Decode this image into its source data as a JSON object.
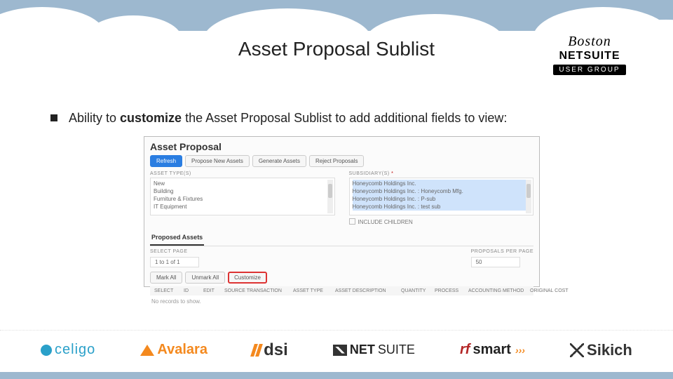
{
  "header": {
    "title": "Asset Proposal Sublist",
    "badge_boston": "Boston",
    "badge_netsuite": "NETSUITE",
    "badge_usergroup": "USER GROUP"
  },
  "bullet": {
    "pre": "Ability to ",
    "bold": "customize",
    "post": " the Asset Proposal Sublist to add additional fields to view:"
  },
  "panel": {
    "title": "Asset Proposal",
    "buttons": {
      "refresh": "Refresh",
      "propose": "Propose New Assets",
      "generate": "Generate Assets",
      "reject": "Reject Proposals"
    },
    "left_label": "ASSET TYPE(S)",
    "right_label": "SUBSIDIARY(S)",
    "asset_types": [
      "New",
      "Building",
      "Furniture & Fixtures",
      "IT Equipment"
    ],
    "subsidiaries": [
      "Honeycomb Holdings Inc.",
      "Honeycomb Holdings Inc. : Honeycomb Mfg.",
      "Honeycomb Holdings Inc. : P-sub",
      "Honeycomb Holdings Inc. : test sub"
    ],
    "include_children": "INCLUDE CHILDREN",
    "tab": "Proposed Assets",
    "pager_left_label": "SELECT PAGE",
    "pager_left_value": "1 to 1 of 1",
    "pager_right_label": "PROPOSALS PER PAGE",
    "pager_right_value": "50",
    "actions": {
      "mark": "Mark All",
      "unmark": "Unmark All",
      "customize": "Customize"
    },
    "grid_headers": [
      "SELECT",
      "ID",
      "EDIT",
      "SOURCE TRANSACTION",
      "ASSET TYPE",
      "ASSET DESCRIPTION",
      "QUANTITY",
      "PROCESS",
      "ACCOUNTING METHOD",
      "ORIGINAL COST"
    ],
    "no_results": "No records to show."
  },
  "footer_logos": {
    "celigo": "celigo",
    "avalara": "Avalara",
    "dsi": "dsi",
    "netsuite_a": "NET",
    "netsuite_b": "SUITE",
    "rfsmart_a": "rf",
    "rfsmart_b": "smart",
    "sikich": "Sikich"
  }
}
